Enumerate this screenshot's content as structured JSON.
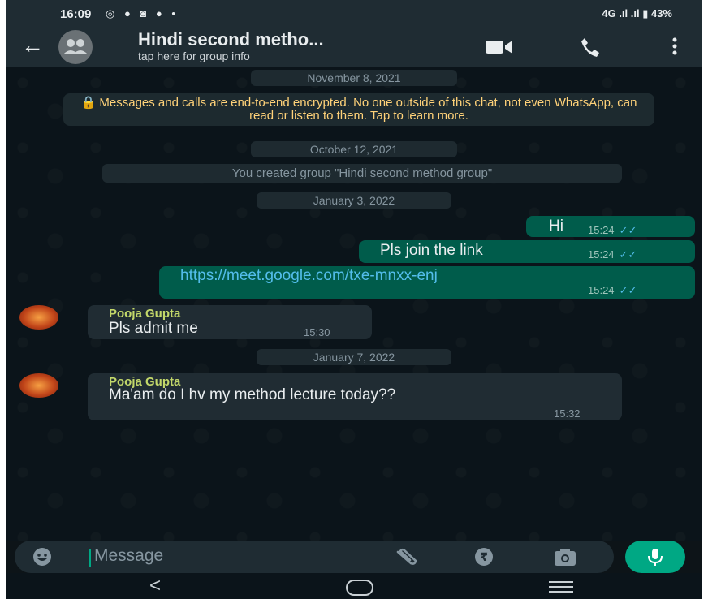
{
  "status_bar": {
    "time": "16:09",
    "left_icons": "◎ ● ◙ ● •",
    "right_text": "4G .ıl .ıl ▮ 43%"
  },
  "header": {
    "back_icon": "arrow-left",
    "title": "Hindi second metho...",
    "subtitle": "tap here for group info",
    "actions": [
      "video-call-icon",
      "voice-call-icon",
      "more-options-icon"
    ]
  },
  "chat": {
    "dates": [
      "November 8, 2021",
      "October 12, 2021",
      "January 3, 2022",
      "January 7, 2022"
    ],
    "encryption_notice": "🔒 Messages and calls are end-to-end encrypted. No one outside of this chat, not even WhatsApp, can read or listen to them. Tap to learn more.",
    "system_message": "You created group \"Hindi second method group\"",
    "messages": [
      {
        "direction": "out",
        "text": "Hi",
        "time": "15:24",
        "ticks": "✓✓"
      },
      {
        "direction": "out",
        "text": "Pls join the link",
        "time": "15:24",
        "ticks": "✓✓"
      },
      {
        "direction": "out",
        "text": "https://meet.google.com/txe-mnxx-enj",
        "time": "15:24",
        "ticks": "✓✓"
      },
      {
        "direction": "in",
        "sender": "Pooja Gupta",
        "text": "Pls admit me",
        "time": "15:30"
      },
      {
        "direction": "in",
        "sender": "Pooja Gupta",
        "text": "Ma'am do I hv my method lecture today??",
        "time": "15:32"
      }
    ]
  },
  "composer": {
    "placeholder": "Message",
    "icons": [
      "emoji-icon",
      "attach-icon",
      "rupee-icon",
      "camera-icon",
      "mic-icon"
    ]
  },
  "colors": {
    "background": "#0b141a",
    "header": "#1f2c33",
    "outgoing_bubble": "#005c4b",
    "incoming_bubble": "#202c33",
    "accent": "#00a884",
    "sender_name": "#c3d86a",
    "encryption_text": "#ffd279"
  }
}
